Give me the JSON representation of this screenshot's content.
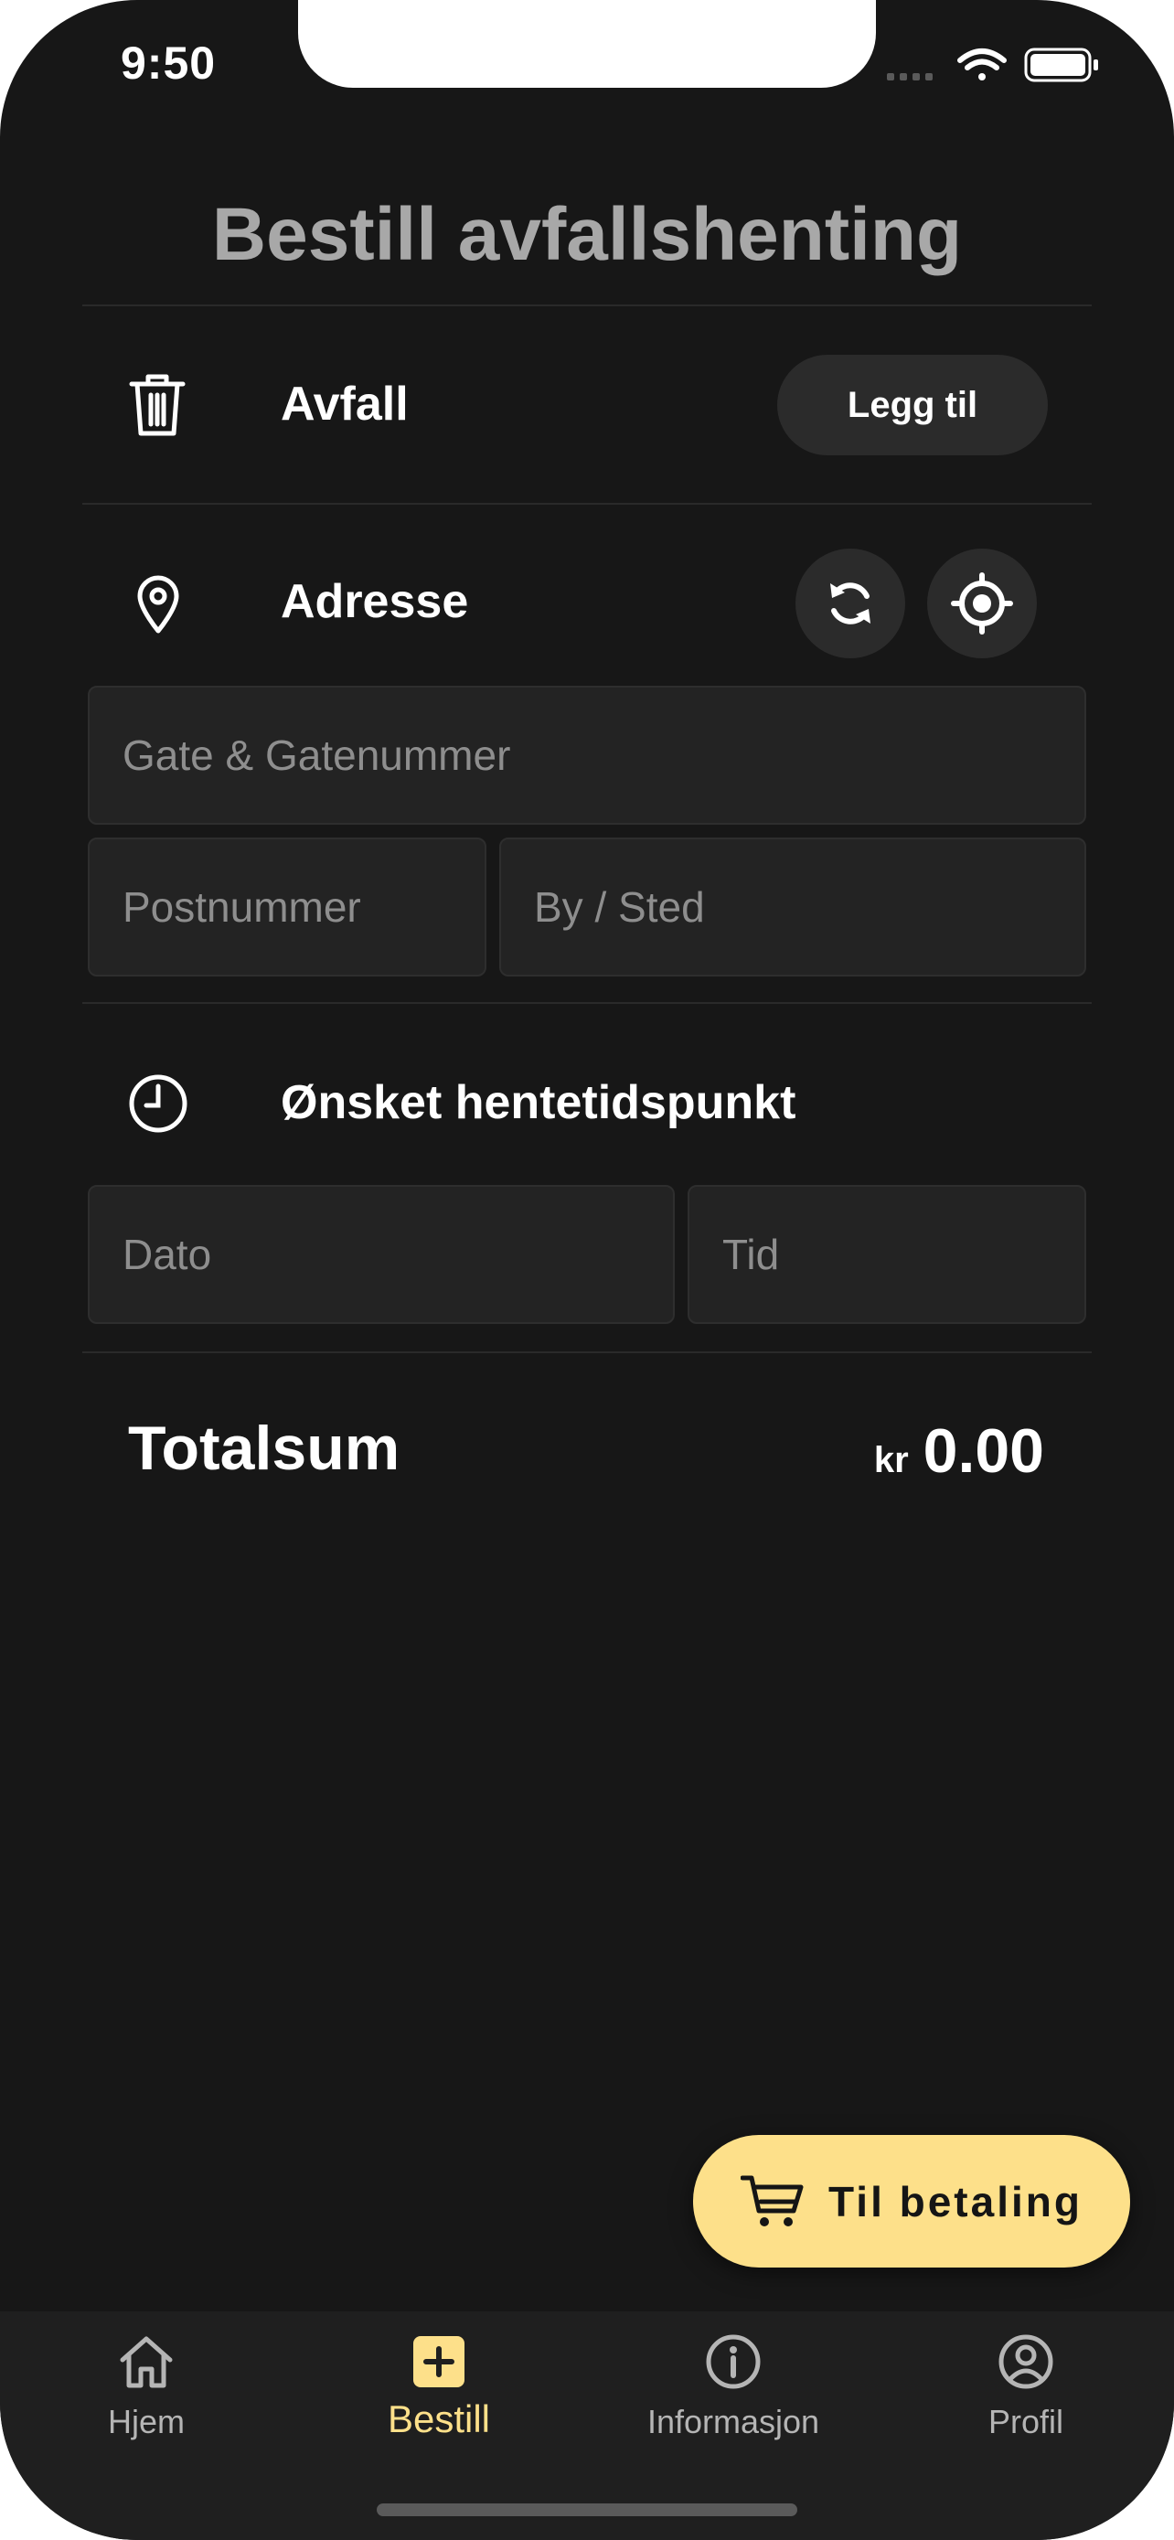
{
  "status": {
    "time": "9:50"
  },
  "page": {
    "title": "Bestill avfallshenting"
  },
  "waste": {
    "label": "Avfall",
    "icon": "trash-icon",
    "add_button": "Legg til"
  },
  "address": {
    "label": "Adresse",
    "icon": "location-pin-icon",
    "refresh_icon": "refresh-icon",
    "locate_icon": "crosshair-icon",
    "street_placeholder": "Gate & Gatenummer",
    "postal_placeholder": "Postnummer",
    "city_placeholder": "By / Sted"
  },
  "pickup": {
    "label": "Ønsket hentetidspunkt",
    "icon": "clock-icon",
    "date_placeholder": "Dato",
    "time_placeholder": "Tid"
  },
  "total": {
    "label": "Totalsum",
    "currency": "kr",
    "amount": "0.00"
  },
  "checkout": {
    "label": "Til betaling",
    "icon": "cart-icon"
  },
  "tabs": [
    {
      "label": "Hjem",
      "icon": "home-icon",
      "active": false
    },
    {
      "label": "Bestill",
      "icon": "plus-square-icon",
      "active": true
    },
    {
      "label": "Informasjon",
      "icon": "info-icon",
      "active": false
    },
    {
      "label": "Profil",
      "icon": "profile-icon",
      "active": false
    }
  ],
  "colors": {
    "background": "#171717",
    "accent": "#fde08a",
    "field": "#232323",
    "muted": "#8e8e8e"
  }
}
